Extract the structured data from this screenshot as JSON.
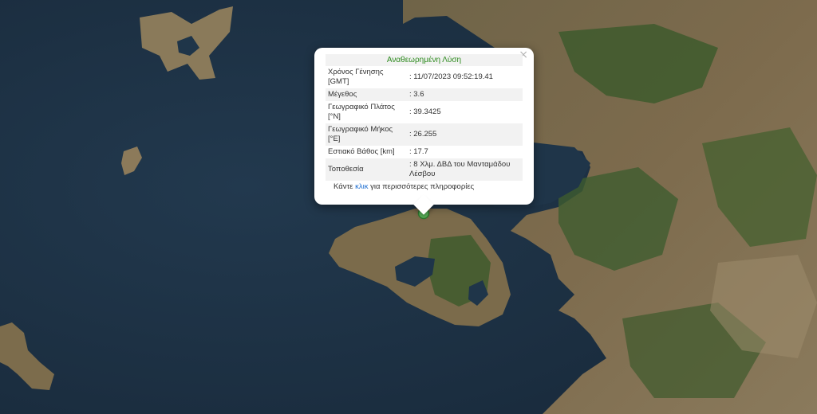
{
  "popup": {
    "title": "Αναθεωρημένη Λύση",
    "close": "×",
    "rows": [
      {
        "label": "Χρόνος Γένησης [GMT]",
        "value": ": 11/07/2023 09:52:19.41"
      },
      {
        "label": "Μέγεθος",
        "value": ": 3.6"
      },
      {
        "label": "Γεωγραφικό Πλάτος [°N]",
        "value": ": 39.3425"
      },
      {
        "label": "Γεωγραφικό Μήκος [°E]",
        "value": ": 26.255"
      },
      {
        "label": "Εστιακό Βάθος [km]",
        "value": ": 17.7"
      },
      {
        "label": "Τοποθεσία",
        "value": ": 8 Χλμ. ΔΒΔ του Μανταμάδου Λέσβου"
      }
    ],
    "more_prefix": "Κάντε ",
    "more_link": "κλικ",
    "more_suffix": " για περισσότερες πληροφορίες"
  },
  "colors": {
    "sea": "#1e3448",
    "land": "#7a6a4a",
    "vegetation": "#3f5a2e",
    "marker": "#5cb85c",
    "title_green": "#2e8b1f",
    "link": "#1f6fd1"
  }
}
